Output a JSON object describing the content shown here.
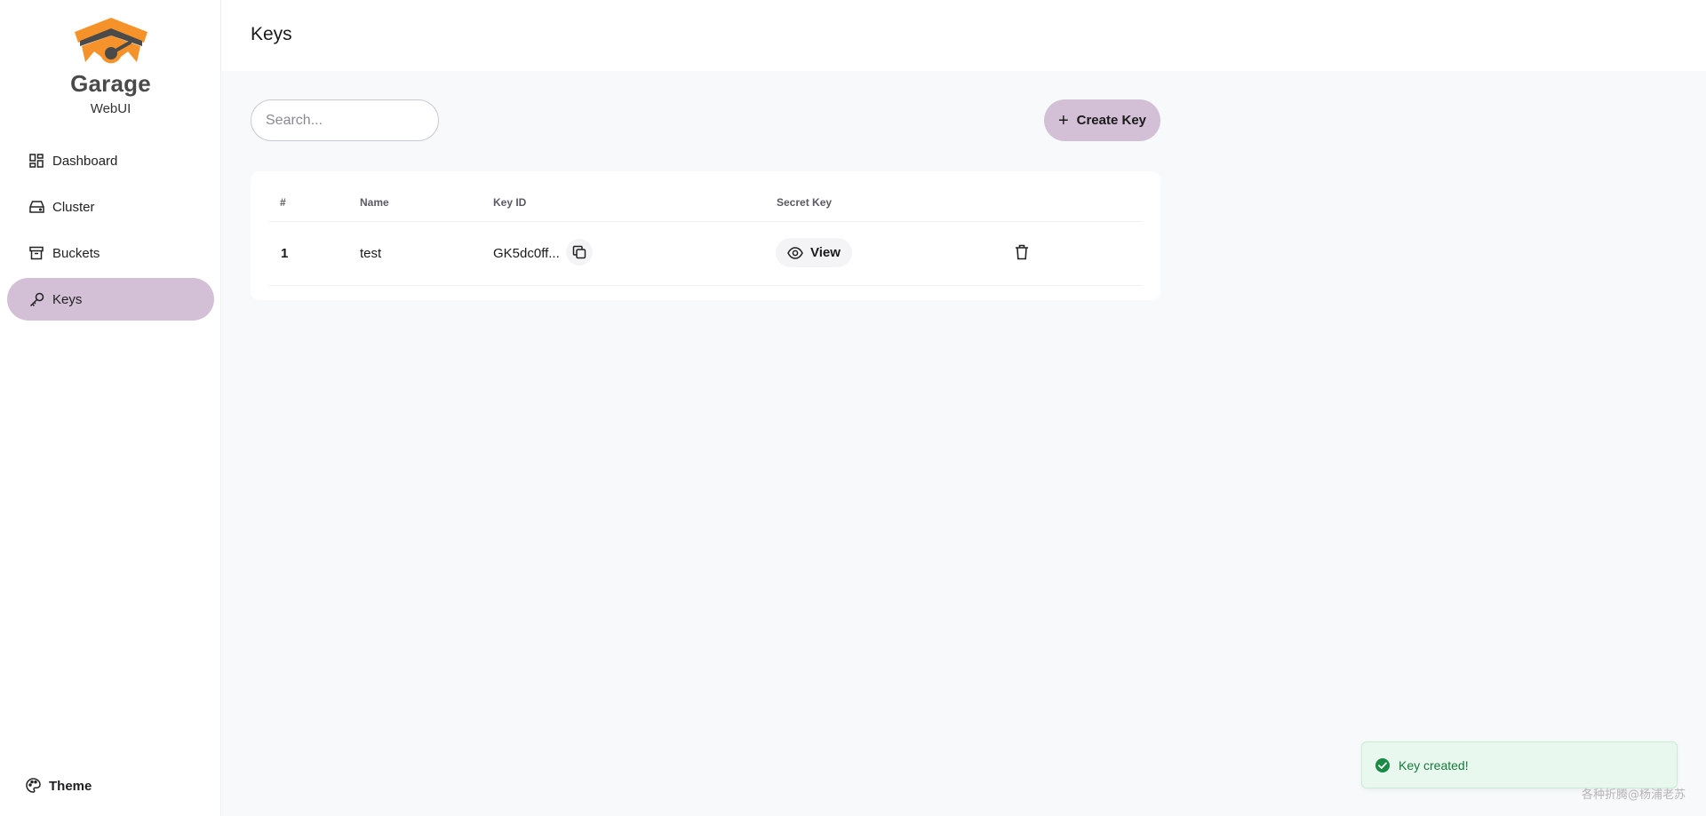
{
  "brand": {
    "name": "Garage",
    "subtitle": "WebUI"
  },
  "sidebar": {
    "items": [
      {
        "label": "Dashboard",
        "icon": "dashboard-icon",
        "active": false
      },
      {
        "label": "Cluster",
        "icon": "hard-drive-icon",
        "active": false
      },
      {
        "label": "Buckets",
        "icon": "archive-box-icon",
        "active": false
      },
      {
        "label": "Keys",
        "icon": "key-icon",
        "active": true
      }
    ],
    "theme_label": "Theme"
  },
  "header": {
    "title": "Keys"
  },
  "toolbar": {
    "search_placeholder": "Search...",
    "create_label": "Create Key",
    "create_icon": "plus-icon"
  },
  "table": {
    "columns": [
      "#",
      "Name",
      "Key ID",
      "Secret Key"
    ],
    "rows": [
      {
        "num": "1",
        "name": "test",
        "key_id": "GK5dc0ff...",
        "secret_action": "View"
      }
    ]
  },
  "toast": {
    "message": "Key created!",
    "status": "success"
  },
  "watermark": "各种折腾@杨浦老苏",
  "colors": {
    "accent": "#d3c0d6",
    "brand_orange": "#f5922a",
    "brand_gray": "#4a4a4a",
    "success": "#167a3a",
    "success_bg": "#e9f8ee",
    "page_bg": "#f8f9fb"
  }
}
